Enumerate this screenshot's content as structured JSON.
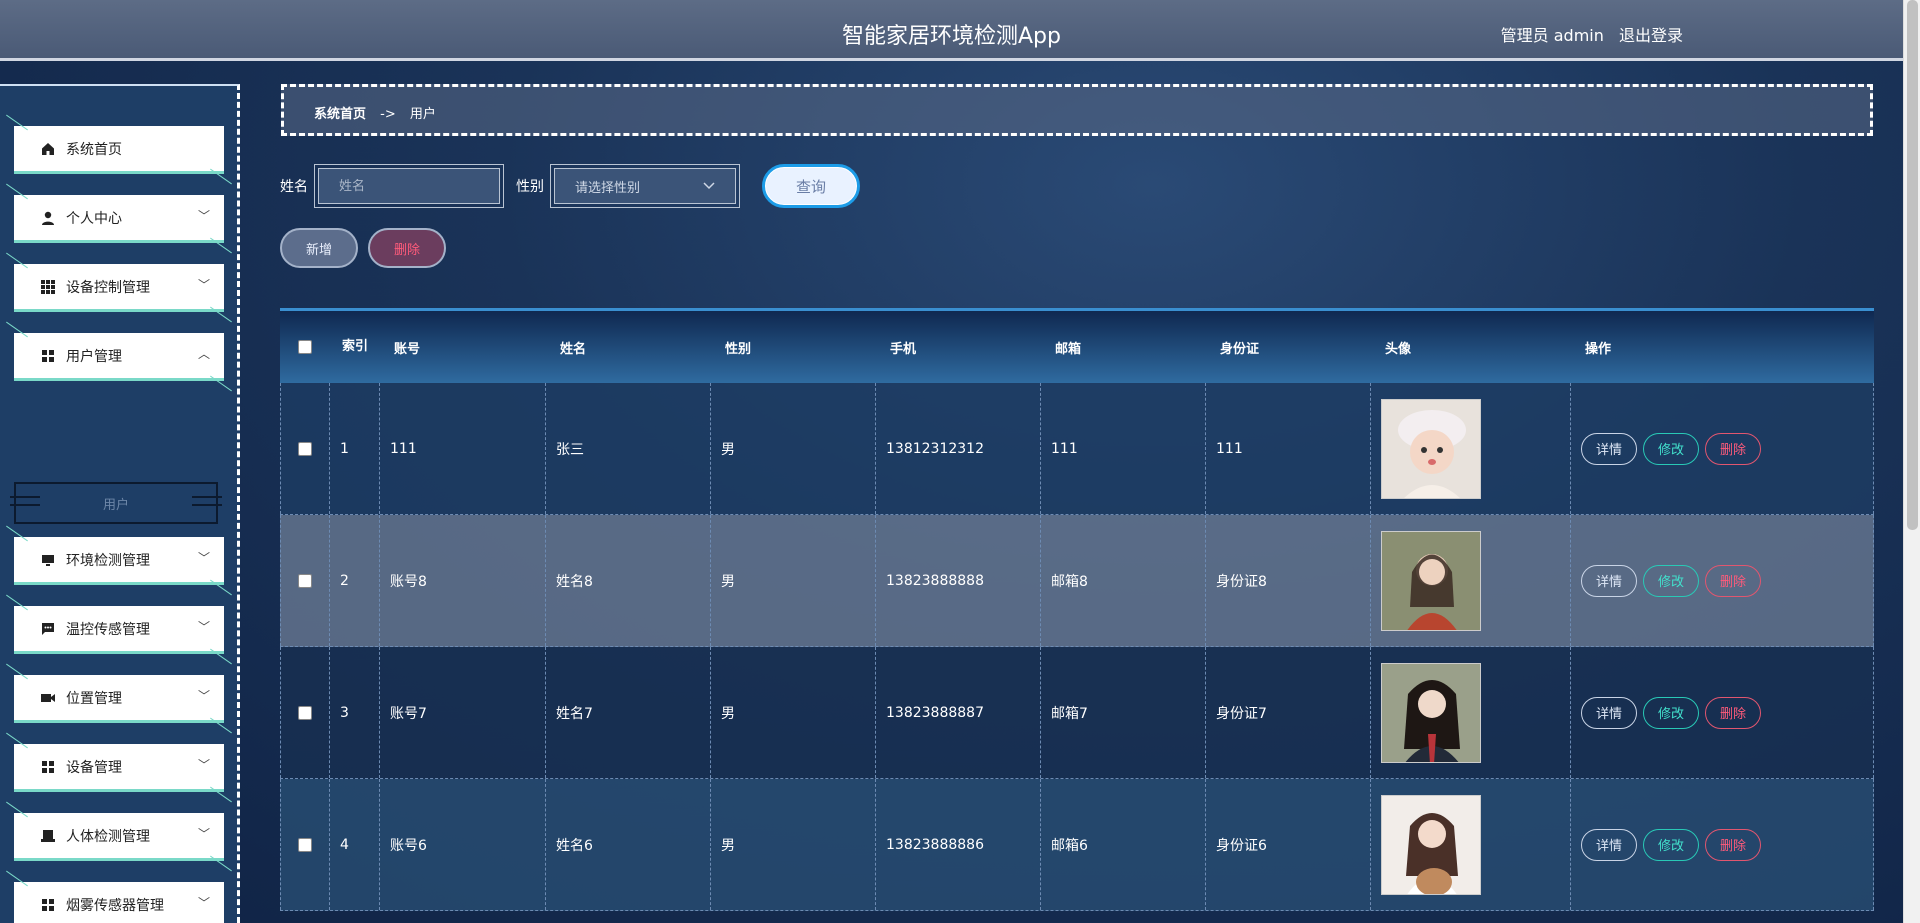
{
  "header": {
    "title": "智能家居环境检测App",
    "user_label": "管理员 admin",
    "logout": "退出登录"
  },
  "sidebar": {
    "items": [
      {
        "label": "系统首页",
        "icon": "home-icon"
      },
      {
        "label": "个人中心",
        "icon": "person-icon"
      },
      {
        "label": "设备控制管理",
        "icon": "grid-icon"
      },
      {
        "label": "用户管理",
        "icon": "apps-icon"
      },
      {
        "label": "环境检测管理",
        "icon": "monitor-icon"
      },
      {
        "label": "温控传感管理",
        "icon": "chat-icon"
      },
      {
        "label": "位置管理",
        "icon": "video-icon"
      },
      {
        "label": "设备管理",
        "icon": "apps-icon"
      },
      {
        "label": "人体检测管理",
        "icon": "print-icon"
      },
      {
        "label": "烟雾传感器管理",
        "icon": "apps-icon"
      }
    ],
    "sub_item": "用户"
  },
  "breadcrumb": {
    "home": "系统首页",
    "separator": "->",
    "current": "用户"
  },
  "search": {
    "name_label": "姓名",
    "name_placeholder": "姓名",
    "sex_label": "性别",
    "sex_placeholder": "请选择性别",
    "query_button": "查询"
  },
  "actions": {
    "add": "新增",
    "delete": "删除"
  },
  "table": {
    "headers": {
      "index": "索引",
      "account": "账号",
      "name": "姓名",
      "sex": "性别",
      "phone": "手机",
      "email": "邮箱",
      "id_card": "身份证",
      "avatar": "头像",
      "op": "操作"
    },
    "rows": [
      {
        "index": "1",
        "account": "111",
        "name": "张三",
        "sex": "男",
        "phone": "13812312312",
        "email": "111",
        "id_card": "111"
      },
      {
        "index": "2",
        "account": "账号8",
        "name": "姓名8",
        "sex": "男",
        "phone": "13823888888",
        "email": "邮箱8",
        "id_card": "身份证8"
      },
      {
        "index": "3",
        "account": "账号7",
        "name": "姓名7",
        "sex": "男",
        "phone": "13823888887",
        "email": "邮箱7",
        "id_card": "身份证7"
      },
      {
        "index": "4",
        "account": "账号6",
        "name": "姓名6",
        "sex": "男",
        "phone": "13823888886",
        "email": "邮箱6",
        "id_card": "身份证6"
      }
    ],
    "row_buttons": {
      "detail": "详情",
      "edit": "修改",
      "delete": "删除"
    }
  },
  "colors": {
    "accent": "#1c9ce8",
    "edit": "#29c9b6",
    "danger": "#e2566f"
  }
}
